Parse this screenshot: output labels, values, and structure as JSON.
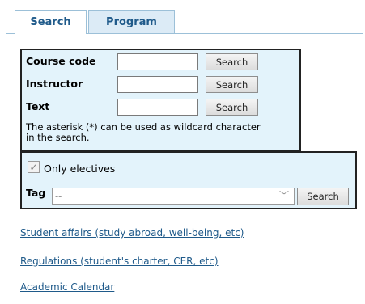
{
  "tabs": [
    {
      "label": "Search"
    },
    {
      "label": "Program"
    }
  ],
  "search": {
    "rows": [
      {
        "label": "Course code",
        "value": "",
        "button": "Search"
      },
      {
        "label": "Instructor",
        "value": "",
        "button": "Search"
      },
      {
        "label": "Text",
        "value": "",
        "button": "Search"
      }
    ],
    "note": "The asterisk (*) can be used as wildcard character in the search."
  },
  "electives": {
    "checkbox_label": "Only electives",
    "checked": true,
    "tag_label": "Tag",
    "tag_value": "--",
    "tag_button": "Search"
  },
  "links": [
    {
      "label": "Student affairs (study abroad, well-being, etc)"
    },
    {
      "label": "Regulations (student's charter, CER, etc)"
    },
    {
      "label": "Academic Calendar"
    }
  ]
}
